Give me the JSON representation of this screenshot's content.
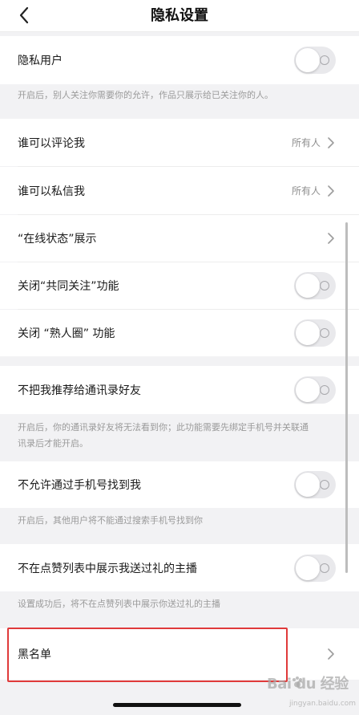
{
  "nav": {
    "title": "隐私设置",
    "back_icon": "chevron-left-icon"
  },
  "sections": {
    "private_user": {
      "label": "隐私用户",
      "enabled": false,
      "note": "开启后，别人关注你需要你的允许，作品只展示给已关注你的人。"
    },
    "comment": {
      "label": "谁可以评论我",
      "value": "所有人"
    },
    "message": {
      "label": "谁可以私信我",
      "value": "所有人"
    },
    "online_status": {
      "label": "“在线状态”展示"
    },
    "mutual_follow": {
      "label": "关闭“共同关注”功能",
      "enabled": false
    },
    "acquaintance": {
      "label": "关闭 “熟人圈” 功能",
      "enabled": false
    },
    "contacts_recommend": {
      "label": "不把我推荐给通讯录好友",
      "enabled": false,
      "note_line1": "开启后，你的通讯录好友将无法看到你；此功能需要先绑定手机号并关联通",
      "note_line2": "讯录后才能开启。"
    },
    "phone_search": {
      "label": "不允许通过手机号找到我",
      "enabled": false,
      "note": "开启后，其他用户将不能通过搜索手机号找到你"
    },
    "gift_anchor": {
      "label": "不在点赞列表中展示我送过礼的主播",
      "enabled": false,
      "note": "设置成功后，将不在点赞列表中展示你送过礼的主播"
    },
    "blacklist": {
      "label": "黑名单"
    }
  },
  "watermark": {
    "logo": "Bai du 经验",
    "site": "jingyan.baidu.com"
  },
  "colors": {
    "background": "#f2f2f4",
    "toggle_off": "#e9e9ec",
    "highlight": "#e03a3a",
    "secondary_text": "#8e8e8e"
  }
}
